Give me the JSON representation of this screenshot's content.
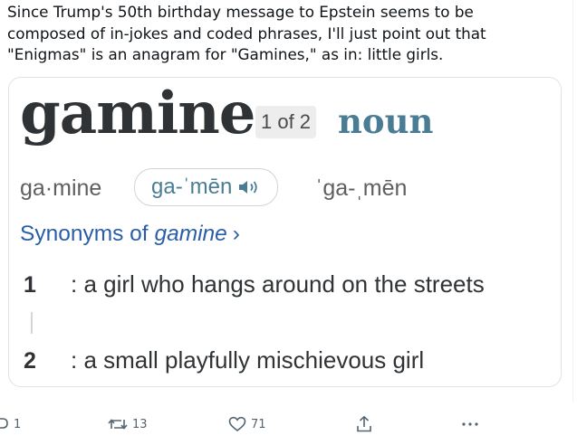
{
  "post": {
    "text_lines": [
      "Since Trump's 50th birthday message to Epstein seems to be",
      "composed of in-jokes and coded phrases, I'll just point out that",
      "\"Enigmas\" is an anagram for \"Gamines,\" as in: little girls."
    ]
  },
  "dictionary": {
    "headword": "gamine",
    "entry_count": "1 of 2",
    "part_of_speech": "noun",
    "syllables": "ga·mine",
    "pronunciation": "ga-ˈmēn",
    "pronunciation_alt": "ˈga-ˌmēn",
    "synonyms_prefix": "Synonyms of ",
    "synonyms_word": "gamine",
    "synonyms_chevron": "›",
    "definitions": [
      {
        "number": "1",
        "text": ": a girl who hangs around on the streets"
      },
      {
        "number": "2",
        "text": ": a small playfully mischievous girl"
      }
    ]
  },
  "actions": {
    "reply_count": "1",
    "repost_count": "13",
    "like_count": "71"
  },
  "colors": {
    "headword": "#303336",
    "part_of_speech": "#4a7d95",
    "link": "#2a5ea8",
    "action_gray": "#536471"
  },
  "icons": {
    "speaker": "speaker-icon",
    "reply": "reply-icon",
    "repost": "repost-icon",
    "like": "heart-icon",
    "share": "share-icon",
    "more": "more-icon"
  }
}
